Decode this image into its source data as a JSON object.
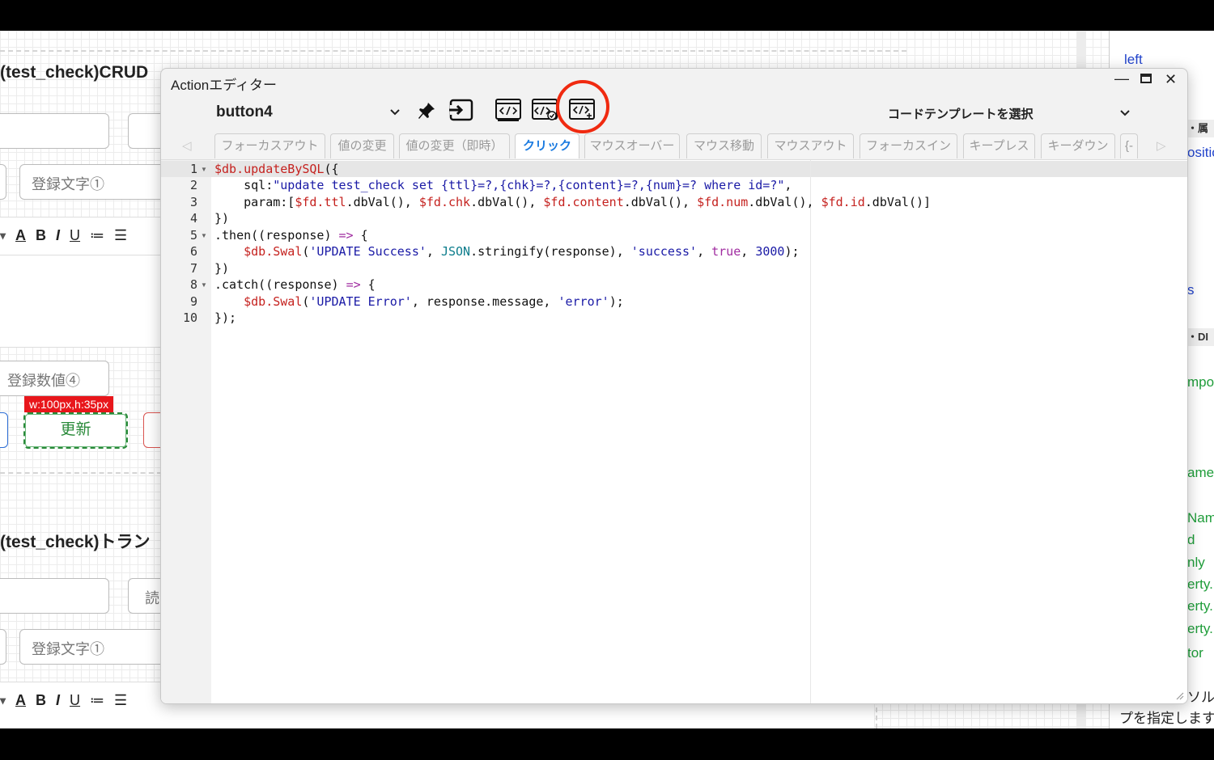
{
  "background": {
    "section1_title": "(test_check)CRUD",
    "section2_title": "(test_check)トラン",
    "field_text1": "登録文字①",
    "field_text4": "登録数値④",
    "field_text1b": "登録文字①",
    "size_tag": "w:100px,h:35px",
    "update_button": "更新",
    "read_partial": "読",
    "toolbar_items": [
      "A",
      "B",
      "I",
      "U",
      "≔",
      "☰"
    ]
  },
  "right_panel": {
    "items": [
      {
        "text": "left",
        "style": "blue"
      },
      {
        "text": "・属",
        "style": "head"
      },
      {
        "text": "ositio",
        "style": "blue"
      },
      {
        "text": "s",
        "style": "blue"
      },
      {
        "text": "・DI",
        "style": "head"
      },
      {
        "text": "mpor",
        "style": "green"
      },
      {
        "text": "ame",
        "style": "green"
      },
      {
        "text": "Nam",
        "style": "green"
      },
      {
        "text": "d",
        "style": "green"
      },
      {
        "text": "nly",
        "style": "green"
      },
      {
        "text": "erty.",
        "style": "green"
      },
      {
        "text": "erty.",
        "style": "green"
      },
      {
        "text": "erty.",
        "style": "green"
      },
      {
        "text": "tor",
        "style": "green"
      }
    ],
    "footer1": "ソル",
    "footer2": "プを指定します"
  },
  "editor": {
    "title": "Actionエディター",
    "target": "button4",
    "template_placeholder": "コードテンプレートを選択",
    "tabs": [
      {
        "label": "フォーカスアウト",
        "active": false
      },
      {
        "label": "値の変更",
        "active": false
      },
      {
        "label": "値の変更（即時）",
        "active": false
      },
      {
        "label": "クリック",
        "active": true
      },
      {
        "label": "マウスオーバー",
        "active": false
      },
      {
        "label": "マウス移動",
        "active": false
      },
      {
        "label": "マウスアウト",
        "active": false
      },
      {
        "label": "フォーカスイン",
        "active": false
      },
      {
        "label": "キープレス",
        "active": false
      },
      {
        "label": "キーダウン",
        "active": false
      },
      {
        "label": "{-",
        "active": false
      }
    ],
    "line_numbers": [
      "1",
      "2",
      "3",
      "4",
      "5",
      "6",
      "7",
      "8",
      "9",
      "10"
    ],
    "code_lines": [
      "$db.updateBySQL({",
      "    sql:\"update test_check set {ttl}=?,{chk}=?,{content}=?,{num}=? where id=?\",",
      "    param:[$fd.ttl.dbVal(), $fd.chk.dbVal(), $fd.content.dbVal(), $fd.num.dbVal(), $fd.id.dbVal()]",
      "})",
      ".then((response) => {",
      "    $db.Swal('UPDATE Success', JSON.stringify(response), 'success', true, 3000);",
      "})",
      ".catch((response) => {",
      "    $db.Swal('UPDATE Error', response.message, 'error');",
      "});"
    ],
    "icons": {
      "pin": "pin-icon",
      "export": "export-icon",
      "code1": "code-window-icon",
      "code2": "code-check-icon",
      "code3": "code-new-icon"
    },
    "highlight_color": "#f02a10",
    "active_tab_color": "#1a7ae0"
  }
}
